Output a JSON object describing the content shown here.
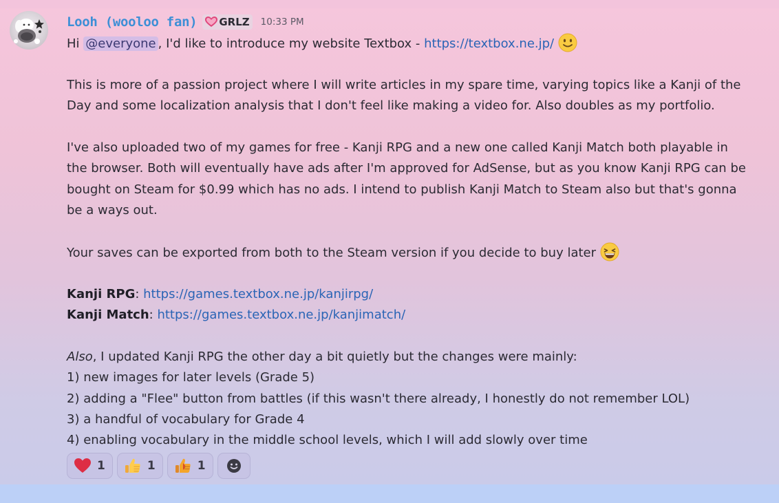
{
  "message": {
    "author": "Looh (wooloo fan)",
    "guild_tag": "GRLZ",
    "timestamp": "10:33 PM",
    "line1_prefix": "Hi ",
    "mention": "@everyone",
    "line1_mid": ", I'd like to introduce my website Textbox - ",
    "website_link": "https://textbox.ne.jp/",
    "para2_line1": "This is more of a passion project where I will write articles in my spare time, varying topics like a Kanji of the",
    "para2_line2": "Day and some localization analysis that I don't feel like making a video for. Also doubles as my portfolio.",
    "para3_line1": "I've also uploaded two of my games for free - Kanji RPG and a new one called Kanji Match both playable in",
    "para3_line2": "the browser. Both will eventually have ads after I'm approved for AdSense, but as you know Kanji RPG can be",
    "para3_line3": "bought on Steam for $0.99 which has no ads. I intend to publish Kanji Match to Steam also but that's gonna",
    "para3_line4": "be a ways out.",
    "para4": "Your saves can be exported from both to the Steam version if you decide to buy later ",
    "kanji_rpg_label": "Kanji RPG",
    "kanji_rpg_link": "https://games.textbox.ne.jp/kanjirpg/",
    "kanji_match_label": "Kanji Match",
    "kanji_match_link": "https://games.textbox.ne.jp/kanjimatch/",
    "colon": ": ",
    "also_italic": "Also",
    "also_rest": ", I updated Kanji RPG the other day a bit quietly but the changes were mainly:",
    "changes": [
      "1) new images for later levels (Grade 5)",
      "2) adding a \"Flee\" button from battles (if this wasn't there already, I honestly do not remember LOL)",
      "3) a handful of vocabulary for Grade 4",
      "4) enabling vocabulary in the middle school levels, which I will add slowly over time"
    ]
  },
  "reactions": [
    {
      "icon": "heart-icon",
      "count": "1"
    },
    {
      "icon": "thumbs-up-icon",
      "count": "1"
    },
    {
      "icon": "thumbs-up-dark-icon",
      "count": "1"
    }
  ],
  "colors": {
    "username": "#3d8fd6",
    "link": "#2a64b5",
    "mention_bg": "#d4bde6",
    "bg_top": "#f6c6dc",
    "bg_bottom": "#c9cbea"
  }
}
